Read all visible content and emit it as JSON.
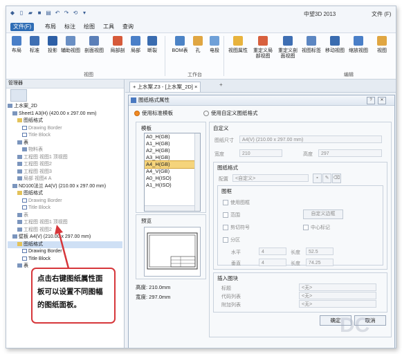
{
  "window": {
    "title": "中望3D 2013",
    "file_label": "文件 (F)"
  },
  "menu": [
    {
      "label": "文件(F)",
      "active": true
    },
    {
      "label": "布局"
    },
    {
      "label": "标注"
    },
    {
      "label": "绘图"
    },
    {
      "label": "工具"
    },
    {
      "label": "查询"
    }
  ],
  "ribbon": {
    "buttons": [
      "布局",
      "标准",
      "投影",
      "辅助视图",
      "剖面视图",
      "局部剖",
      "局部",
      "断裂",
      "BOM表",
      "孔",
      "电极",
      "视图属性",
      "重定义局部视图",
      "重定义剖面视图",
      "视图标签",
      "移动视图",
      "缩放视图",
      "视图"
    ],
    "groups": [
      "视图",
      "工作台",
      "编辑"
    ]
  },
  "left_panel": {
    "header": "管理器",
    "tree": [
      {
        "text": "上水案_2D",
        "indent": 0,
        "kind": "doc"
      },
      {
        "text": "Sheet1 A3(H) (420.00 x 297.00 mm)",
        "indent": 1,
        "kind": "doc"
      },
      {
        "text": "图纸格式",
        "indent": 2,
        "kind": "folder"
      },
      {
        "text": "Drawing Border",
        "indent": 3,
        "kind": "tpl",
        "faded": true
      },
      {
        "text": "Title Block",
        "indent": 3,
        "kind": "tpl",
        "faded": true
      },
      {
        "text": "表",
        "indent": 2,
        "kind": "doc"
      },
      {
        "text": "物料表",
        "indent": 3,
        "kind": "doc",
        "faded": true
      },
      {
        "text": "工程图 视图1 顶视图",
        "indent": 2,
        "kind": "doc",
        "faded": true
      },
      {
        "text": "工程图 视图2",
        "indent": 2,
        "kind": "doc",
        "faded": true
      },
      {
        "text": "工程图 视图3",
        "indent": 2,
        "kind": "doc",
        "faded": true
      },
      {
        "text": "局部 视图4 A",
        "indent": 2,
        "kind": "doc",
        "faded": true
      },
      {
        "text": "ND100法兰 A4(V) (210.00 x 297.00 mm)",
        "indent": 1,
        "kind": "doc"
      },
      {
        "text": "图纸格式",
        "indent": 2,
        "kind": "folder"
      },
      {
        "text": "Drawing Border",
        "indent": 3,
        "kind": "tpl",
        "faded": true
      },
      {
        "text": "Title Block",
        "indent": 3,
        "kind": "tpl",
        "faded": true
      },
      {
        "text": "表",
        "indent": 2,
        "kind": "doc",
        "faded": true
      },
      {
        "text": "工程图 视图1 顶视图",
        "indent": 2,
        "kind": "doc",
        "faded": true
      },
      {
        "text": "工程图 视图2",
        "indent": 2,
        "kind": "doc",
        "faded": true
      },
      {
        "text": "壁板 A4(V) (210.00 x 297.00 mm)",
        "indent": 1,
        "kind": "doc"
      },
      {
        "text": "图纸格式",
        "indent": 2,
        "kind": "folder",
        "selected": true
      },
      {
        "text": "Drawing Border",
        "indent": 3,
        "kind": "tpl"
      },
      {
        "text": "Title Block",
        "indent": 3,
        "kind": "tpl"
      },
      {
        "text": "表",
        "indent": 2,
        "kind": "doc"
      }
    ]
  },
  "callout": {
    "line1": "点击右键图纸属性面",
    "line2": "板可以设置不同图幅",
    "line3": "的图纸面板。"
  },
  "tabs": {
    "doc_tab": "+ 上水案.Z3 - [上水案_2D] ×",
    "plus": "+"
  },
  "dialog": {
    "title": "图纸格式属性",
    "radio_standard": "使用标准模板",
    "radio_custom": "使用自定义图纸格式",
    "template_label": "模板",
    "templates": [
      "A0_H(GB)",
      "A1_H(GB)",
      "A2_H(GB)",
      "A3_H(GB)",
      "A4_H(GB)",
      "A4_V(GB)",
      "A0_H(ISO)",
      "A1_H(ISO)"
    ],
    "selected_template": "A4_H(GB)",
    "preview_label": "预览",
    "height_text": "高度: 210.0mm",
    "width_text": "宽度: 297.0mm",
    "custom": {
      "label": "自定义",
      "size_label": "图纸尺寸",
      "size_value": "A4(V) (210.00 x 297.00 mm)",
      "width_label": "宽度",
      "width_value": "210",
      "height_label": "高度",
      "height_value": "297"
    },
    "format": {
      "label": "图纸格式",
      "config_label": "配置",
      "config_value": "<自定义>",
      "frame_label": "图框",
      "use_frame": "使用图框",
      "range": "范围",
      "custom_border": "自定义边框",
      "cut_marks": "剪切符号",
      "center_mark": "中心标记",
      "zones": "分区",
      "horizontal": "水平",
      "horizontal_count": "4",
      "h_length_label": "长度",
      "h_length": "52.5",
      "vertical": "垂直",
      "vertical_count": "4",
      "v_length_label": "长度",
      "v_length": "74.25"
    },
    "insert_block": {
      "label": "插入图块",
      "title": "标题",
      "code_list": "代码列表",
      "attach_list": "附加列表",
      "none": "<无>"
    },
    "ok": "确定",
    "cancel": "取消"
  },
  "colors": {
    "accent": "#2f6db5",
    "callout_border": "#d6363a",
    "selected_item": "#f5d47c"
  }
}
